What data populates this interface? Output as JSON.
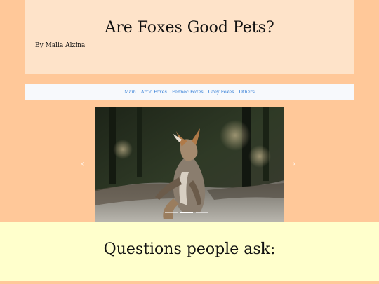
{
  "header": {
    "title": "Are Foxes Good Pets?",
    "byline": "By Malia Alzina"
  },
  "nav": {
    "items": [
      "Main",
      "Artic Foxes",
      "Fennec Foxes",
      "Grey Foxes",
      "Others"
    ]
  },
  "carousel": {
    "image": "fox-standing-on-hind-legs-photo",
    "prev_icon": "chevron-left-icon",
    "next_icon": "chevron-right-icon",
    "slide_count": 3,
    "active_slide": 1
  },
  "questions": {
    "title": "Questions people ask:"
  },
  "colors": {
    "page_bg": "#ffc899",
    "header_bg": "#fee3c9",
    "nav_bg": "#f7f9fc",
    "link": "#2f7bd6",
    "questions_bg": "#ffffcc"
  }
}
